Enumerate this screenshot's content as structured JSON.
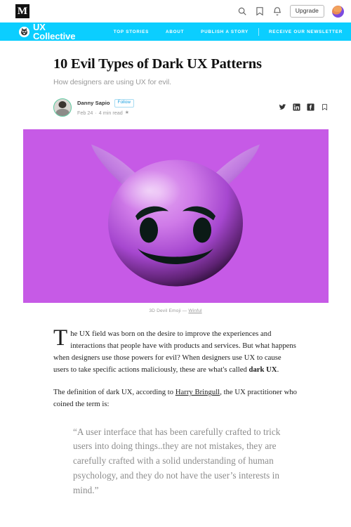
{
  "topbar": {
    "logo_label": "M",
    "icons": [
      {
        "name": "search-icon",
        "label": "Search"
      },
      {
        "name": "bookmarks-icon",
        "label": "Bookmarks"
      },
      {
        "name": "notifications-bell-icon",
        "label": "Notifications"
      }
    ],
    "upgrade_label": "Upgrade",
    "avatar_label": "User avatar"
  },
  "publication_nav": {
    "brand_name": "UX Collective",
    "brand_mark": "ux-collective-cat-icon",
    "background_color": "#0bceff",
    "links": [
      {
        "label": "TOP STORIES"
      },
      {
        "label": "ABOUT"
      },
      {
        "label": "PUBLISH A STORY"
      },
      {
        "label": "RECEIVE OUR NEWSLETTER"
      }
    ]
  },
  "article": {
    "title": "10 Evil Types of Dark UX Patterns",
    "subtitle": "How designers are using UX for evil.",
    "author": {
      "name": "Danny Sapio",
      "follow_label": "Follow",
      "date": "Feb 24",
      "separator": "·",
      "read_time": "4 min read",
      "member_star": "★"
    },
    "share_icons": [
      {
        "name": "twitter-share-icon",
        "label": "Share on Twitter"
      },
      {
        "name": "linkedin-share-icon",
        "label": "Share on LinkedIn"
      },
      {
        "name": "facebook-share-icon",
        "label": "Share on Facebook"
      },
      {
        "name": "bookmark-icon",
        "label": "Save story"
      }
    ],
    "hero": {
      "alt": "3D purple devil emoji on magenta background",
      "background_color": "#c65ae6",
      "emoji_color": "#b24fd8",
      "caption_text": "3D Devil Emoji — ",
      "caption_link": "Winful"
    },
    "paragraphs": [
      {
        "dropcap": "T",
        "text_before_bold": "he UX field was born on the desire to improve the experiences and interactions that people have with products and services. But what happens when designers use those powers for evil? When designers use UX to cause users to take specific actions maliciously, these are what's called ",
        "bold_text": "dark UX",
        "text_after_bold": "."
      },
      {
        "text_before_link": "The definition of dark UX, according to ",
        "link_text": "Harry Bringull",
        "text_after_link": ", the UX practitioner who coined the term is:"
      }
    ],
    "blockquote": "“A user interface that has been carefully crafted to trick users into doing things..they are not mistakes, they are carefully crafted with a solid understanding of human psychology, and they do not have the user’s interests in mind.”"
  }
}
